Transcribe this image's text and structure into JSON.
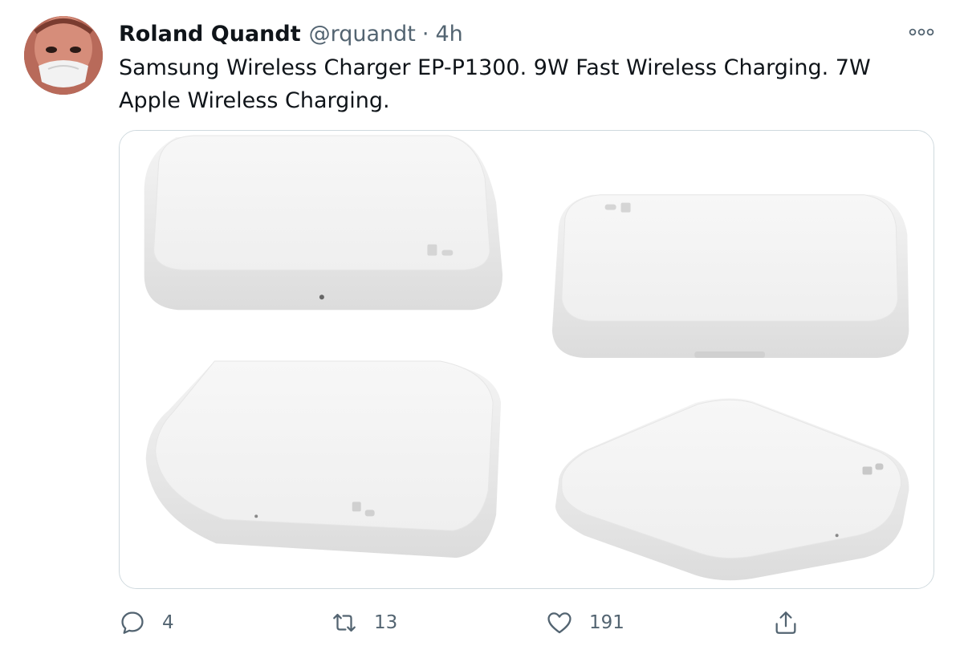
{
  "tweet": {
    "author_name": "Roland Quandt",
    "handle": "@rquandt",
    "separator": "·",
    "time": "4h",
    "text": "Samsung Wireless Charger EP-P1300. 9W Fast Wireless Charging. 7W Apple Wireless Charging."
  },
  "actions": {
    "reply_count": "4",
    "retweet_count": "13",
    "like_count": "191"
  },
  "icons": {
    "more": "more-horizontal-icon",
    "reply": "reply-icon",
    "retweet": "retweet-icon",
    "like": "heart-icon",
    "share": "share-icon"
  },
  "colors": {
    "text_primary": "#0f1419",
    "text_secondary": "#536471",
    "border": "#cfd9de"
  }
}
